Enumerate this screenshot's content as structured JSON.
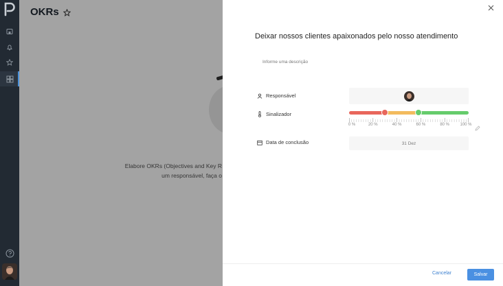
{
  "page": {
    "title": "OKRs",
    "empty_text_line1": "Elabore OKRs (Objectives and Key R",
    "empty_text_line2": "um responsável, faça o"
  },
  "sidebar": {
    "items": [
      {
        "icon": "home-icon"
      },
      {
        "icon": "bell-icon"
      },
      {
        "icon": "star-icon"
      },
      {
        "icon": "grid-icon",
        "active": true
      }
    ],
    "help_icon": "help-icon"
  },
  "drawer": {
    "title": "Deixar nossos clientes apaixonados pelo nosso atendimento",
    "description_placeholder": "Informe uma descrição",
    "responsavel_label": "Responsável",
    "sinalizador_label": "Sinalizador",
    "data_label": "Data de conclusão",
    "date_value": "31 Dez",
    "slider": {
      "ticks": [
        "0 %",
        "20 %",
        "40 %",
        "60 %",
        "80 %",
        "100 %"
      ],
      "thumb_low_percent": 30,
      "thumb_high_percent": 58,
      "colors": {
        "low": "#e8675c",
        "mid": "#f3bb5e",
        "high": "#66cc6c"
      }
    },
    "cancel_label": "Cancelar",
    "save_label": "Salvar"
  },
  "colors": {
    "rail": "#222a33",
    "accent": "#4a90e2"
  }
}
